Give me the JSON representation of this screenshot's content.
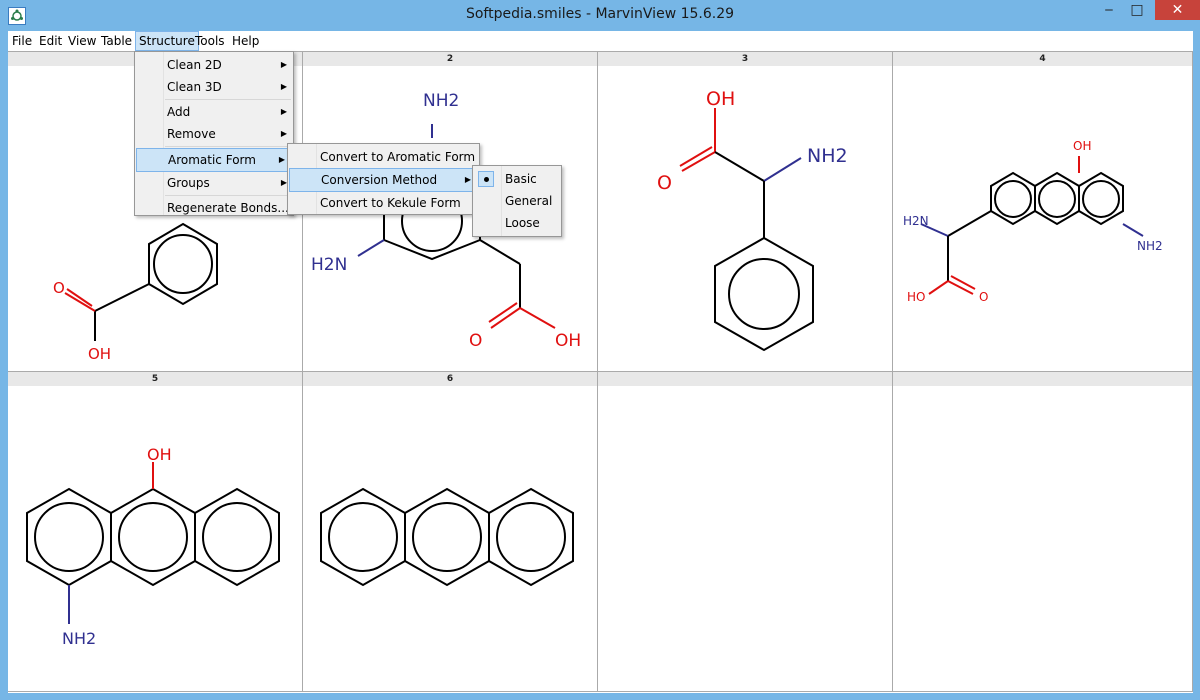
{
  "window": {
    "title": "Softpedia.smiles - MarvinView 15.6.29",
    "min_glyph": "‒",
    "max_glyph": "□",
    "close_glyph": "✕"
  },
  "menubar": [
    "File",
    "Edit",
    "View",
    "Table",
    "Structure",
    "Tools",
    "Help"
  ],
  "structure_menu": {
    "items": [
      "Clean 2D",
      "Clean 3D",
      "Add",
      "Remove",
      "Aromatic Form",
      "Groups",
      "Regenerate Bonds..."
    ]
  },
  "aromatic_submenu": {
    "items": [
      "Convert to Aromatic Form",
      "Conversion Method",
      "Convert to Kekule Form"
    ]
  },
  "method_submenu": {
    "items": [
      "Basic",
      "General",
      "Loose"
    ],
    "selected": "Basic"
  },
  "cells": [
    {
      "number": "",
      "labels": {
        "o": "O",
        "oh": "OH"
      }
    },
    {
      "number": "2",
      "labels": {
        "nh2_top": "NH2",
        "h2n": "H2N",
        "o": "O",
        "oh": "OH"
      }
    },
    {
      "number": "3",
      "labels": {
        "oh": "OH",
        "o": "O",
        "nh2": "NH2"
      }
    },
    {
      "number": "4",
      "labels": {
        "oh": "OH",
        "h2n": "H2N",
        "ho": "HO",
        "o": "O",
        "nh2": "NH2"
      }
    },
    {
      "number": "5",
      "labels": {
        "oh": "OH",
        "nh2": "NH2"
      }
    },
    {
      "number": "6",
      "labels": {}
    },
    {
      "number": "",
      "labels": {}
    },
    {
      "number": "",
      "labels": {}
    }
  ],
  "colors": {
    "oxygen": "#e01010",
    "nitrogen": "#303090",
    "bond": "#000000",
    "highlight": "#cce4f7"
  }
}
